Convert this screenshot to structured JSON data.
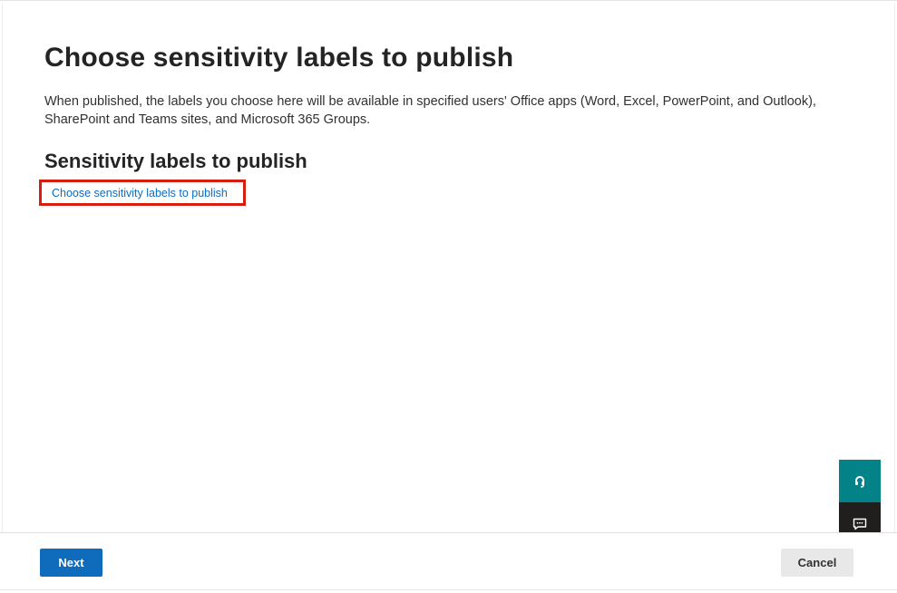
{
  "page": {
    "title": "Choose sensitivity labels to publish",
    "description": "When published, the labels you choose here will be available in specified users' Office apps (Word, Excel, PowerPoint, and Outlook), SharePoint and Teams sites, and Microsoft 365 Groups.",
    "section_heading": "Sensitivity labels to publish",
    "choose_link": "Choose sensitivity labels to publish"
  },
  "footer": {
    "next_label": "Next",
    "cancel_label": "Cancel"
  },
  "floating_buttons": {
    "help_icon": "headset-icon",
    "feedback_icon": "feedback-icon"
  },
  "colors": {
    "primary": "#0f6cbd",
    "highlight_box": "#d71e0e",
    "help_button": "#038387",
    "feedback_button": "#201f1e"
  }
}
